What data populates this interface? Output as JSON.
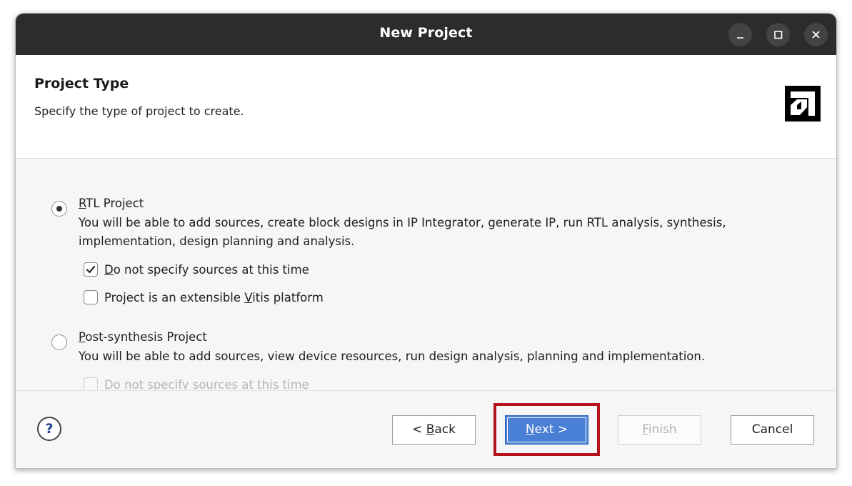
{
  "window": {
    "title": "New Project"
  },
  "header": {
    "title": "Project Type",
    "subtitle": "Specify the type of project to create."
  },
  "options": {
    "rtl": {
      "label_mnemonic": "R",
      "label_rest": "TL Project",
      "selected": true,
      "description_line1": "You will be able to add sources, create block designs in IP Integrator, generate IP, run RTL analysis, synthesis,",
      "description_line2": "implementation, design planning and analysis.",
      "do_not_specify": {
        "mnemonic": "D",
        "rest": "o not specify sources at this time",
        "checked": true
      },
      "extensible": {
        "prefix": "Project is an extensible ",
        "mnemonic": "V",
        "rest": "itis platform",
        "checked": false
      }
    },
    "post_synthesis": {
      "label_mnemonic": "P",
      "label_rest": "ost-synthesis Project",
      "selected": false,
      "description": "You will be able to add sources, view device resources, run design analysis, planning and implementation.",
      "do_not_specify_disabled": "Do not specify sources at this time"
    }
  },
  "footer": {
    "help_label": "?",
    "back": {
      "prefix": "< ",
      "mnemonic": "B",
      "rest": "ack"
    },
    "next": {
      "mnemonic": "N",
      "rest": "ext >"
    },
    "finish": {
      "mnemonic": "F",
      "rest": "inish"
    },
    "cancel": "Cancel"
  },
  "colors": {
    "titlebar": "#2c2c2c",
    "primary_button": "#4a7fd6",
    "highlight_box": "#b5121b"
  },
  "icons": {
    "minimize": "minimize-icon",
    "maximize": "maximize-icon",
    "close": "close-icon",
    "logo": "amd-logo-icon",
    "help": "help-icon"
  }
}
